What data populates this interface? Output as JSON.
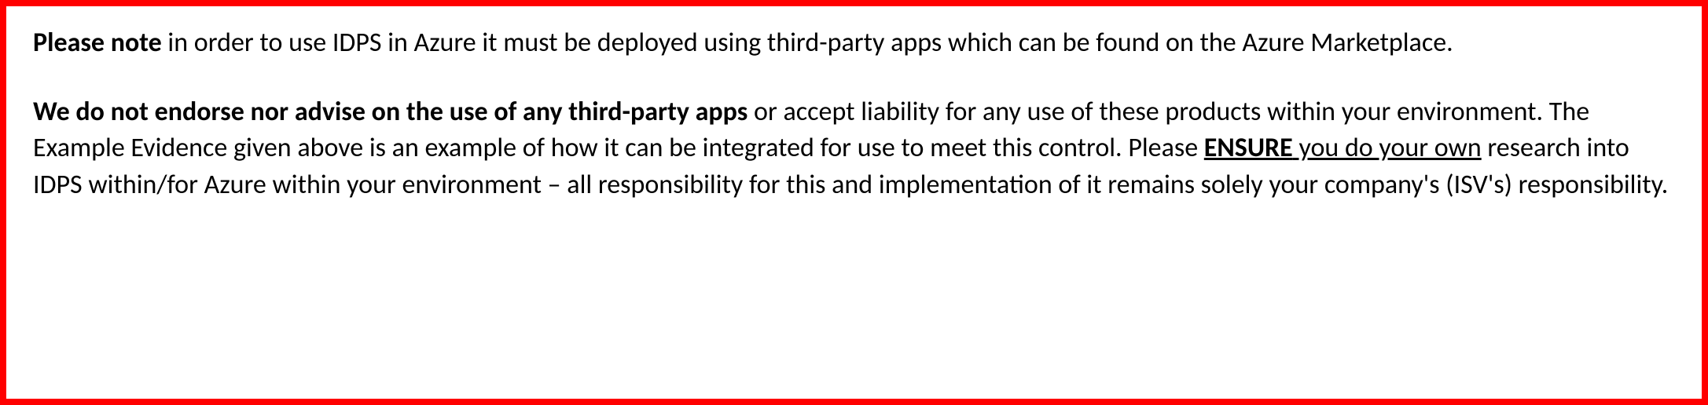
{
  "note": {
    "p1_bold": "Please note",
    "p1_rest": " in order to use IDPS in Azure it must be deployed using third-party apps which can be found on the Azure Marketplace.",
    "p2_bold": "We do not endorse nor advise on the use of any third-party apps",
    "p2_rest_a": " or accept liability for any use of these products within your environment. The Example Evidence given above is an example of how it can be integrated for use to meet this control. Please ",
    "p2_underline_bold": "ENSURE",
    "p2_underline_rest": " you do your own",
    "p2_rest_b": " research into IDPS within/for Azure within your environment – all responsibility for this and implementation of it remains solely your company's (ISV's) responsibility."
  }
}
